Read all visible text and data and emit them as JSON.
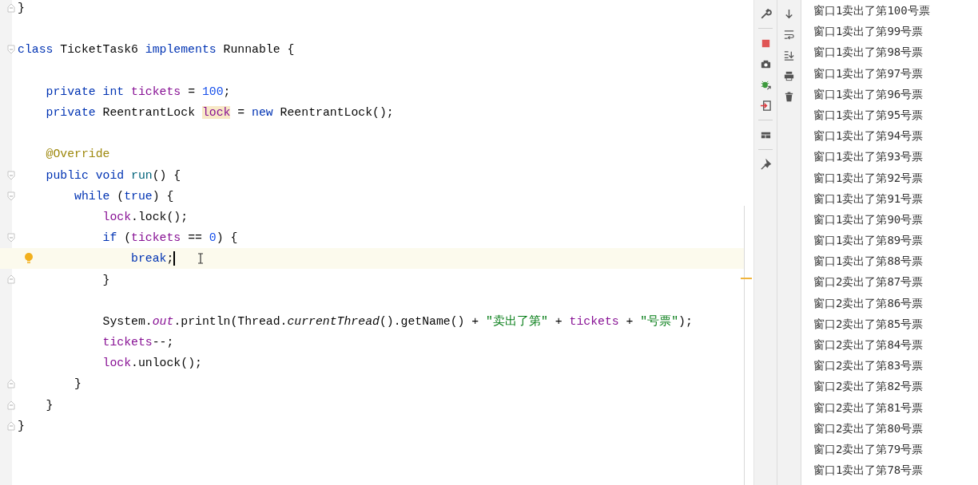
{
  "editor": {
    "lines": [
      {
        "kind": "code",
        "fold_end": true,
        "tokens": [
          {
            "kind": "plain",
            "text": "}"
          }
        ]
      },
      {
        "kind": "blank"
      },
      {
        "kind": "code",
        "fold_start": true,
        "tokens": [
          {
            "kind": "keyword",
            "text": "class "
          },
          {
            "kind": "plain",
            "text": "TicketTask6 "
          },
          {
            "kind": "keyword",
            "text": "implements "
          },
          {
            "kind": "plain",
            "text": "Runnable {"
          }
        ],
        "children": [
          {
            "kind": "blank"
          },
          {
            "kind": "code",
            "tokens": [
              {
                "kind": "keyword",
                "text": "private int "
              },
              {
                "kind": "field",
                "text": "tickets"
              },
              {
                "kind": "plain",
                "text": " = "
              },
              {
                "kind": "number",
                "text": "100"
              },
              {
                "kind": "plain",
                "text": ";"
              }
            ]
          },
          {
            "kind": "code",
            "tokens": [
              {
                "kind": "keyword",
                "text": "private "
              },
              {
                "kind": "plain",
                "text": "ReentrantLock "
              },
              {
                "kind": "field_highlighted",
                "text": "lock"
              },
              {
                "kind": "plain",
                "text": " = "
              },
              {
                "kind": "keyword",
                "text": "new "
              },
              {
                "kind": "plain",
                "text": "ReentrantLock();"
              }
            ]
          },
          {
            "kind": "blank"
          },
          {
            "kind": "code",
            "tokens": [
              {
                "kind": "annotation",
                "text": "@Override"
              }
            ]
          },
          {
            "kind": "code",
            "fold_start": true,
            "tokens": [
              {
                "kind": "keyword",
                "text": "public void "
              },
              {
                "kind": "method",
                "text": "run"
              },
              {
                "kind": "plain",
                "text": "() {"
              }
            ],
            "children": [
              {
                "kind": "code",
                "fold_start": true,
                "tokens": [
                  {
                    "kind": "keyword",
                    "text": "while "
                  },
                  {
                    "kind": "plain",
                    "text": "("
                  },
                  {
                    "kind": "keyword",
                    "text": "true"
                  },
                  {
                    "kind": "plain",
                    "text": ") {"
                  }
                ],
                "children": [
                  {
                    "kind": "code",
                    "tokens": [
                      {
                        "kind": "field",
                        "text": "lock"
                      },
                      {
                        "kind": "plain",
                        "text": ".lock();"
                      }
                    ]
                  },
                  {
                    "kind": "code",
                    "fold_start": true,
                    "tokens": [
                      {
                        "kind": "keyword",
                        "text": "if "
                      },
                      {
                        "kind": "plain",
                        "text": "("
                      },
                      {
                        "kind": "field",
                        "text": "tickets"
                      },
                      {
                        "kind": "plain",
                        "text": " == "
                      },
                      {
                        "kind": "number",
                        "text": "0"
                      },
                      {
                        "kind": "plain",
                        "text": ") {"
                      }
                    ],
                    "children": [
                      {
                        "kind": "code",
                        "current": true,
                        "intention_bulb": true,
                        "tokens": [
                          {
                            "kind": "keyword",
                            "text": "break"
                          },
                          {
                            "kind": "plain",
                            "text": ";"
                          }
                        ]
                      }
                    ]
                  },
                  {
                    "kind": "code",
                    "fold_end": true,
                    "tokens": [
                      {
                        "kind": "plain",
                        "text": "}"
                      }
                    ]
                  },
                  {
                    "kind": "blank"
                  },
                  {
                    "kind": "code",
                    "tokens": [
                      {
                        "kind": "plain",
                        "text": "System."
                      },
                      {
                        "kind": "static_field",
                        "text": "out"
                      },
                      {
                        "kind": "plain",
                        "text": ".println(Thread."
                      },
                      {
                        "kind": "static_method",
                        "text": "currentThread"
                      },
                      {
                        "kind": "plain",
                        "text": "().getName() + "
                      },
                      {
                        "kind": "string",
                        "text": "\"卖出了第\""
                      },
                      {
                        "kind": "plain",
                        "text": " + "
                      },
                      {
                        "kind": "field",
                        "text": "tickets"
                      },
                      {
                        "kind": "plain",
                        "text": " + "
                      },
                      {
                        "kind": "string",
                        "text": "\"号票\""
                      },
                      {
                        "kind": "plain",
                        "text": ");"
                      }
                    ]
                  },
                  {
                    "kind": "code",
                    "tokens": [
                      {
                        "kind": "field",
                        "text": "tickets"
                      },
                      {
                        "kind": "plain",
                        "text": "--;"
                      }
                    ]
                  },
                  {
                    "kind": "code",
                    "tokens": [
                      {
                        "kind": "field",
                        "text": "lock"
                      },
                      {
                        "kind": "plain",
                        "text": ".unlock();"
                      }
                    ]
                  }
                ]
              },
              {
                "kind": "code",
                "fold_end": true,
                "tokens": [
                  {
                    "kind": "plain",
                    "text": "}"
                  }
                ]
              }
            ]
          },
          {
            "kind": "code",
            "fold_end": true,
            "tokens": [
              {
                "kind": "plain",
                "text": "}"
              }
            ]
          }
        ]
      },
      {
        "kind": "code",
        "fold_end": true,
        "tokens": [
          {
            "kind": "plain",
            "text": "}"
          }
        ]
      }
    ]
  },
  "console": {
    "lines": [
      "窗口1卖出了第100号票",
      "窗口1卖出了第99号票",
      "窗口1卖出了第98号票",
      "窗口1卖出了第97号票",
      "窗口1卖出了第96号票",
      "窗口1卖出了第95号票",
      "窗口1卖出了第94号票",
      "窗口1卖出了第93号票",
      "窗口1卖出了第92号票",
      "窗口1卖出了第91号票",
      "窗口1卖出了第90号票",
      "窗口1卖出了第89号票",
      "窗口1卖出了第88号票",
      "窗口2卖出了第87号票",
      "窗口2卖出了第86号票",
      "窗口2卖出了第85号票",
      "窗口2卖出了第84号票",
      "窗口2卖出了第83号票",
      "窗口2卖出了第82号票",
      "窗口2卖出了第81号票",
      "窗口2卖出了第80号票",
      "窗口2卖出了第79号票",
      "窗口1卖出了第78号票"
    ]
  }
}
